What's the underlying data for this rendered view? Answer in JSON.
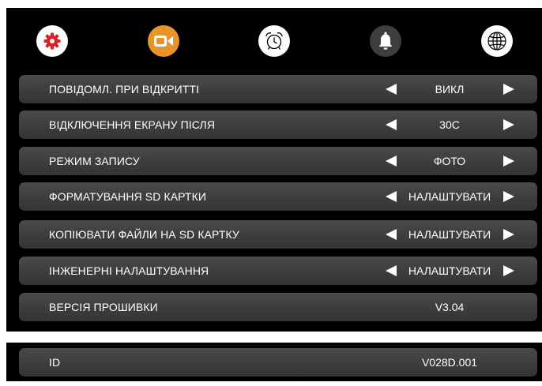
{
  "tabs": [
    {
      "icon": "gear-icon",
      "name": "settings",
      "color": "#d6202a"
    },
    {
      "icon": "video-camera-icon",
      "name": "video",
      "color": "#e9932b"
    },
    {
      "icon": "alarm-clock-icon",
      "name": "alarm",
      "color": "#ffffff"
    },
    {
      "icon": "bell-icon",
      "name": "bell",
      "color": "#3e3e3e"
    },
    {
      "icon": "globe-icon",
      "name": "language",
      "color": "#ffffff"
    }
  ],
  "settings": [
    {
      "label": "ПОВІДОМЛ. ПРИ ВІДКРИТТІ",
      "value": "ВИКЛ"
    },
    {
      "label": "ВІДКЛЮЧЕННЯ ЕКРАНУ ПІСЛЯ",
      "value": "30С"
    },
    {
      "label": "РЕЖИМ ЗАПИСУ",
      "value": "ФОТО"
    },
    {
      "label": "ФОРМАТУВАННЯ SD КАРТКИ",
      "value": "НАЛАШТУВАТИ"
    },
    {
      "label": "КОПІЮВАТИ ФАЙЛИ НА SD КАРТКУ",
      "value": "НАЛАШТУВАТИ"
    },
    {
      "label": "ІНЖЕНЕРНІ НАЛАШТУВАННЯ",
      "value": "НАЛАШТУВАТИ"
    },
    {
      "label": "ВЕРСІЯ ПРОШИВКИ",
      "value": "V3.04"
    }
  ],
  "id_row": {
    "label": "ID",
    "value": "V028D.001"
  },
  "colors": {
    "background": "#000000",
    "row": "#3e3e3e",
    "text": "#ffffff",
    "active_settings": "#d6202a",
    "video": "#e9932b"
  }
}
